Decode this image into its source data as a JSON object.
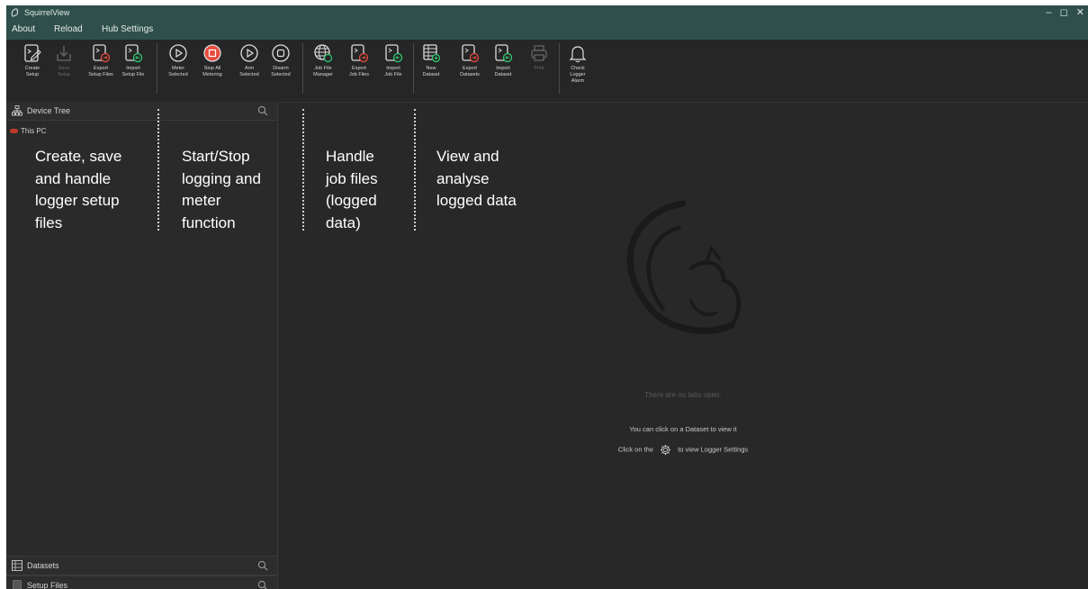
{
  "app": {
    "title": "SquirrelView"
  },
  "window_controls": {
    "minimize": "–",
    "maximize": "◻",
    "close": "✕"
  },
  "menu": [
    {
      "label": "About"
    },
    {
      "label": "Reload"
    },
    {
      "label": "Hub Settings"
    }
  ],
  "toolbar": {
    "create_setup": "Create\nSetup",
    "save_setup": "Save\nSetup",
    "export_setup_files": "Export\nSetup Files",
    "import_setup_file": "Import\nSetup File",
    "meter_selected": "Meter\nSelected",
    "stop_all_metering": "Stop All\nMetering",
    "arm_selected": "Arm\nSelected",
    "disarm_selected": "Disarm\nSelected",
    "job_file_manager": "Job File\nManager",
    "export_job_files": "Export\nJob Files",
    "import_job_file": "Import\nJob File",
    "new_dataset": "New\nDataset",
    "export_datasets": "Export\nDatasets",
    "import_dataset": "Import\nDataset",
    "print": "Print",
    "check_logger_alarm": "Check\nLogger\nAlarm"
  },
  "left_panel": {
    "device_tree": "Device Tree",
    "this_pc": "This PC",
    "datasets": "Datasets",
    "setup_files": "Setup Files"
  },
  "annotations": {
    "setup": "Create, save\nand handle\nlogger setup\nfiles",
    "logging": "Start/Stop\nlogging and\nmeter\nfunction",
    "jobs": "Handle\njob files\n(logged\ndata)",
    "data": "View and\nanalyse\nlogged data"
  },
  "main": {
    "no_tabs": "There are no tabs open.",
    "hint1": "You can click on a Dataset to view it",
    "hint2_prefix": "Click on the",
    "hint2_suffix": "to view Logger Settings"
  },
  "colors": {
    "titlebar": "#2e4f4a",
    "background": "#282828",
    "icon_accent": "#e74c3c",
    "icon_green": "#2ecc71"
  }
}
